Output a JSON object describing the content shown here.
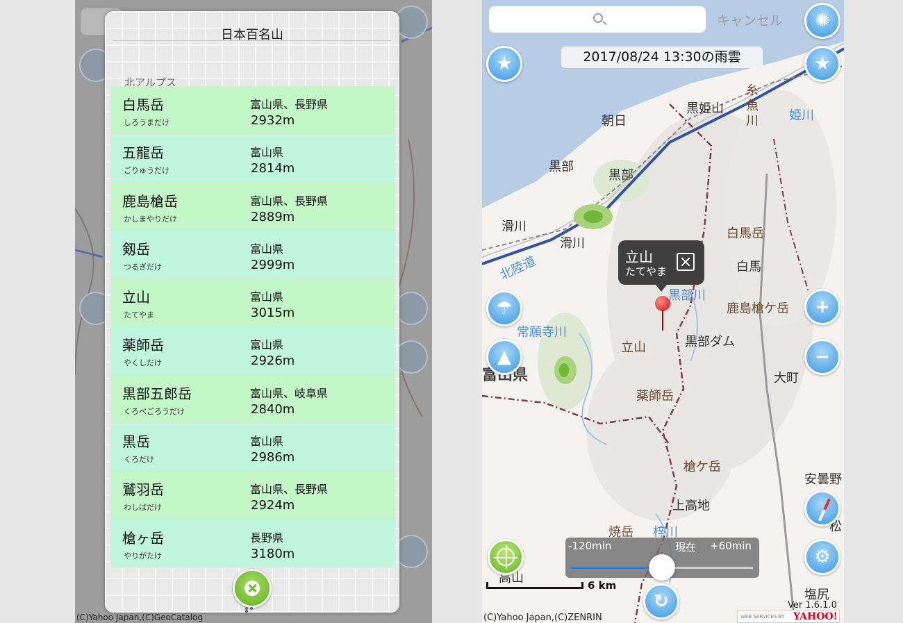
{
  "list_screen": {
    "title": "日本百名山",
    "section": "北アルプス",
    "mountains": [
      {
        "name": "白馬岳",
        "kana": "しろうまだけ",
        "prefecture": "富山県、長野県",
        "height": "2932m"
      },
      {
        "name": "五龍岳",
        "kana": "ごりゅうだけ",
        "prefecture": "富山県",
        "height": "2814m"
      },
      {
        "name": "鹿島槍岳",
        "kana": "かしまやりだけ",
        "prefecture": "富山県、長野県",
        "height": "2889m"
      },
      {
        "name": "剱岳",
        "kana": "つるぎだけ",
        "prefecture": "富山県",
        "height": "2999m"
      },
      {
        "name": "立山",
        "kana": "たてやま",
        "prefecture": "富山県",
        "height": "3015m"
      },
      {
        "name": "薬師岳",
        "kana": "やくしだけ",
        "prefecture": "富山県",
        "height": "2926m"
      },
      {
        "name": "黒部五郎岳",
        "kana": "くろべごろうだけ",
        "prefecture": "富山県、岐阜県",
        "height": "2840m"
      },
      {
        "name": "黒岳",
        "kana": "くろだけ",
        "prefecture": "富山県",
        "height": "2986m"
      },
      {
        "name": "鷲羽岳",
        "kana": "わしばだけ",
        "prefecture": "富山県、長野県",
        "height": "2924m"
      },
      {
        "name": "槍ヶ岳",
        "kana": "やりがたけ",
        "prefecture": "長野県",
        "height": "3180m"
      }
    ],
    "close_icon": "close-icon",
    "copyright": "(C)Yahoo Japan,(C)GeoCatalog"
  },
  "map_screen": {
    "search": {
      "placeholder": "",
      "icon": "search-icon"
    },
    "cancel_label": "キャンセル",
    "radar_label": "2017/08/24 13:30の雨雲",
    "labels": {
      "asahi": "朝日",
      "kurohimeyama": "黒姫山",
      "itoigawa_1": "糸",
      "itoigawa_2": "魚",
      "itoigawa_3": "川",
      "himekawa": "姫川",
      "kurobe_city": "黒部",
      "kurobe_station": "黒部",
      "namerikawa_city": "滑川",
      "namerikawa_station": "滑川",
      "hakubadake": "白馬岳",
      "hakuba": "白馬",
      "hokuriku": "北陸道",
      "kurobegawa": "黒部川",
      "kashimayari": "鹿島槍ケ岳",
      "joganjigawa": "常願寺川",
      "tateyama": "立山",
      "kurobe_dam": "黒部ダム",
      "toyama_pref": "富山県",
      "omachi": "大町",
      "yakushidake": "薬師岳",
      "yarigatake": "槍ケ岳",
      "kamikochi": "上高地",
      "yakedake": "焼岳",
      "azusagawa": "梓川",
      "azumino": "安曇野",
      "matsu": "松",
      "shio": "塩尻",
      "taka": "高山"
    },
    "popup": {
      "name": "立山",
      "kana": "たてやま"
    },
    "timeline": {
      "start": "-120min",
      "now": "現在",
      "end": "+60min",
      "position": 0.5
    },
    "scale": "6 km",
    "version": "Ver 1.6.1.0",
    "copyright": "(C)Yahoo Japan,(C)ZENRIN",
    "yahoo_small": "WEB SERVICES BY",
    "yahoo_logo": "YAHOO!",
    "colors": {
      "accent_blue": "#3a98e2",
      "green_row": "#c4f7c8",
      "mint_row": "#c0f6de",
      "pin_red": "#d21010"
    }
  }
}
